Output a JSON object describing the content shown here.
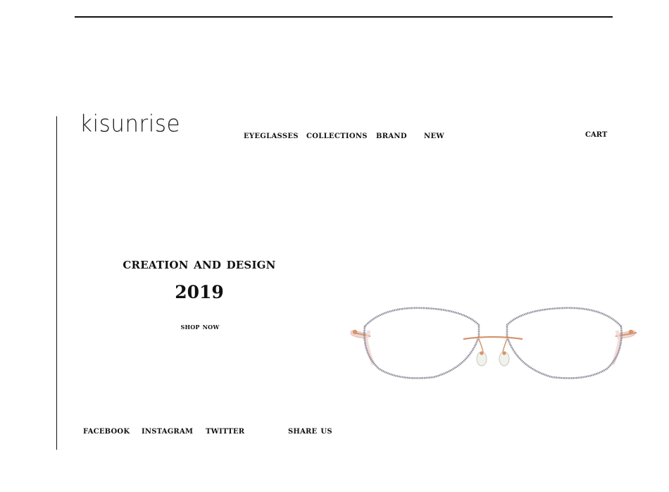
{
  "brand": {
    "logo_text": "kisunrise"
  },
  "nav": {
    "items": [
      {
        "label": "EYEGLASSES"
      },
      {
        "label": "COLLECTIONS"
      },
      {
        "label": "BRAND"
      },
      {
        "label": "NEW"
      }
    ],
    "cart_label": "CART"
  },
  "hero": {
    "title": "CREATION AND DESIGN",
    "year": "2019",
    "cta_label": "SHOP NOW"
  },
  "product_image": {
    "subject": "rimless eyeglasses",
    "frame_color": "#8d8b97",
    "temple_color": "#efd6d2",
    "metal_color": "#d5946a"
  },
  "social": {
    "items": [
      {
        "label": "FACEBOOK"
      },
      {
        "label": "INSTAGRAM"
      },
      {
        "label": "TWITTER"
      }
    ],
    "share_label": "SHARE US"
  }
}
